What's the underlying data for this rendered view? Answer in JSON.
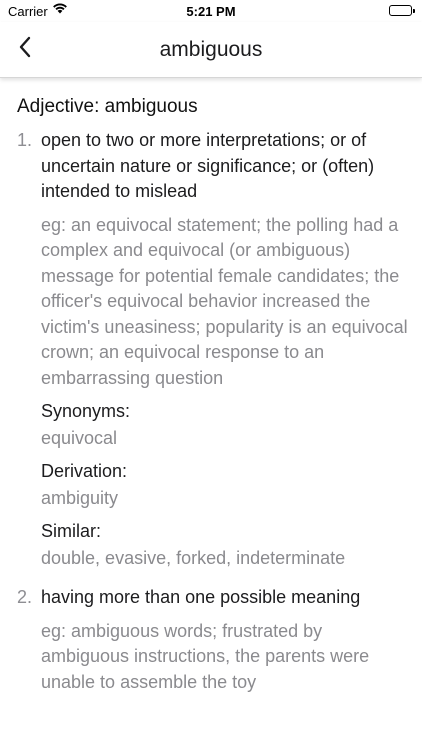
{
  "status_bar": {
    "carrier": "Carrier",
    "time": "5:21 PM"
  },
  "nav": {
    "title": "ambiguous",
    "back_icon": "chevron-left-icon"
  },
  "entry": {
    "heading": "Adjective: ambiguous",
    "senses": [
      {
        "number": "1.",
        "definition": "open to two or more interpretations; or of uncertain nature or significance; or (often) intended to mislead",
        "example": "eg: an equivocal statement; the polling had a complex and equivocal (or ambiguous) message for potential female candidates; the officer's equivocal behavior increased the victim's uneasiness; popularity is an equivocal crown; an equivocal response to an embarrassing question",
        "synonyms_label": "Synonyms:",
        "synonyms": "equivocal",
        "derivation_label": "Derivation:",
        "derivation": "ambiguity",
        "similar_label": "Similar:",
        "similar": "double, evasive, forked, indeterminate"
      },
      {
        "number": "2.",
        "definition": "having more than one possible meaning",
        "example": "eg: ambiguous words; frustrated by ambiguous instructions, the parents were unable to assemble the toy"
      }
    ]
  }
}
